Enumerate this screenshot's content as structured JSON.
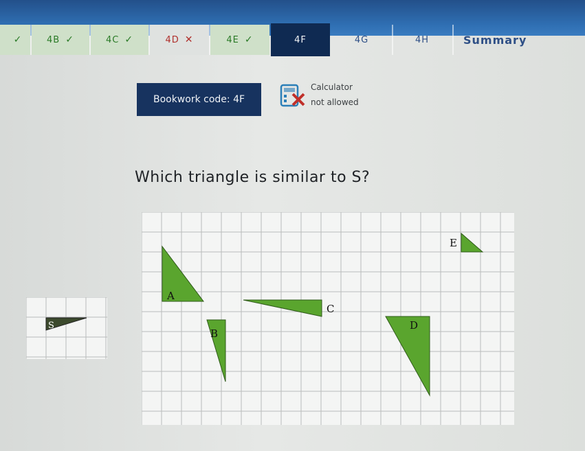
{
  "tabs": [
    {
      "label": "",
      "status": "done",
      "mark": "✓"
    },
    {
      "label": "4B",
      "status": "done",
      "mark": "✓"
    },
    {
      "label": "4C",
      "status": "done",
      "mark": "✓"
    },
    {
      "label": "4D",
      "status": "wrong",
      "mark": "✕"
    },
    {
      "label": "4E",
      "status": "done",
      "mark": "✓"
    },
    {
      "label": "4F",
      "status": "active",
      "mark": ""
    },
    {
      "label": "4G",
      "status": "plain",
      "mark": ""
    },
    {
      "label": "4H",
      "status": "plain",
      "mark": ""
    },
    {
      "label": "Summary",
      "status": "summary",
      "mark": ""
    }
  ],
  "bookwork": {
    "label": "Bookwork code: 4F"
  },
  "calculator": {
    "line1": "Calculator",
    "line2": "not allowed",
    "icon": "calculator-crossed-icon"
  },
  "question": {
    "text": "Which triangle is similar to S?"
  },
  "shapes": {
    "label_A": "A",
    "label_B": "B",
    "label_C": "C",
    "label_D": "D",
    "label_E": "E",
    "label_S": "S"
  },
  "colors": {
    "triangle_green": "#5aa52e",
    "triangle_dark": "#3c4a2d",
    "active_tab": "#0f2a52",
    "bookwork_bg": "#17335f"
  }
}
